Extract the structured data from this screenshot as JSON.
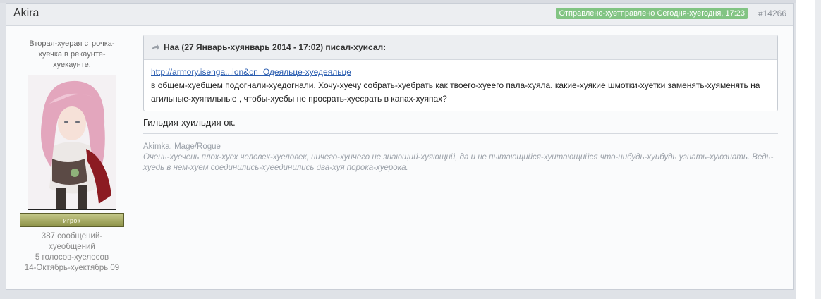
{
  "post": {
    "author": "Akira",
    "date": "Отправлено-хуетправлено Сегодня-хуегодня, 17:23",
    "number": "#14266"
  },
  "author_panel": {
    "title": "Вторая-хуерая строчка-хуечка в рекаунте-хуекаунте.",
    "rank": "игрок",
    "posts": "387 сообщений-хуеобщений",
    "votes": "5 голосов-хуелосов",
    "joined": "14-Октябрь-хуектябрь 09"
  },
  "quote": {
    "header": "Наа (27 Январь-хуянварь 2014 - 17:02) писал-хуисал:",
    "link": "http://armory.isenga...ion&cn=Одеяльце-хуедеяльце",
    "text": "в общем-хуебщем подогнали-хуедогнали.  Хочу-хуечу собрать-хуебрать как твоего-хуеего пала-хуяла. какие-хуякие шмотки-хуетки заменять-хуяменять на агильные-хуягильные , чтобы-хуебы не просрать-хуесрать в капах-хуяпах?"
  },
  "post_text": "Гильдия-хуильдия ок.",
  "signature": {
    "line1": "Akimka. Mage/Rogue",
    "line2": "Очень-хуечень плох-хуех человек-хуеловек, ничего-хуичего не знающий-хуяющий, да и не пытающийся-хуитающийся что-нибудь-хуибудь узнать-хуюзнать. Ведь-хуедь в нем-хуем соединились-хуеединились два-хуя порока-хуерока."
  },
  "colors": {
    "date_badge": "#82c483",
    "link": "#2a5db0",
    "rank_badge": "#a7ab63"
  }
}
